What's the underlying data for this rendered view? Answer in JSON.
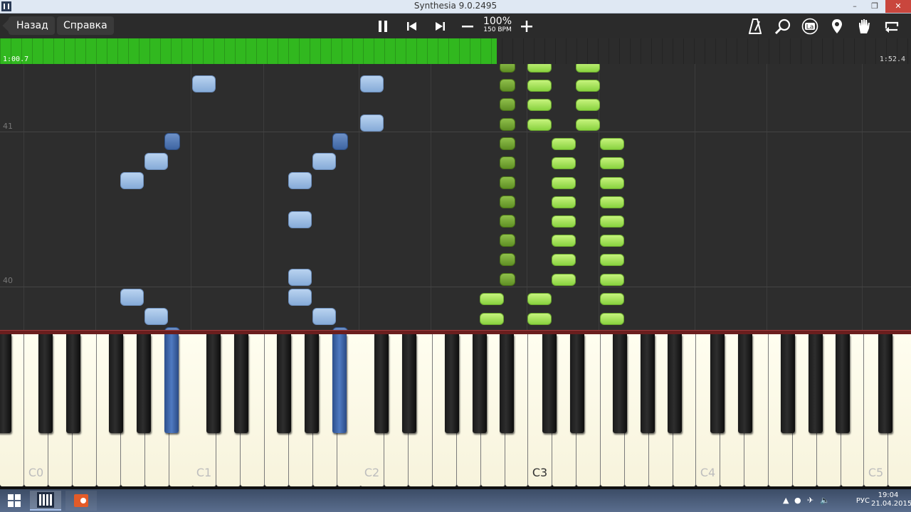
{
  "window": {
    "title": "Synthesia 9.0.2495",
    "minimize": "–",
    "maximize": "❐",
    "close": "✕"
  },
  "toolbar": {
    "back_label": "Назад",
    "help_label": "Справка",
    "speed_percent": "100%",
    "speed_bpm": "150 BPM",
    "icons": [
      "pause-icon",
      "previous-icon",
      "next-icon",
      "minus-icon",
      "plus-icon",
      "metronome-icon",
      "search-icon",
      "la-icon",
      "location-pin-icon",
      "hand-icon",
      "loop-icon"
    ],
    "la_text": "La"
  },
  "progress": {
    "elapsed": "1:00.7",
    "total": "1:52.4",
    "fraction": 0.545,
    "color": "#31b81f"
  },
  "measures": {
    "label_41": "41",
    "label_40": "40"
  },
  "keyboard": {
    "octave_labels": [
      "C0",
      "C1",
      "C2",
      "C3",
      "C4",
      "C5"
    ],
    "active_color": "#3e65a3"
  },
  "taskbar": {
    "language": "РУС",
    "time": "19:04",
    "date": "21.04.2015"
  }
}
